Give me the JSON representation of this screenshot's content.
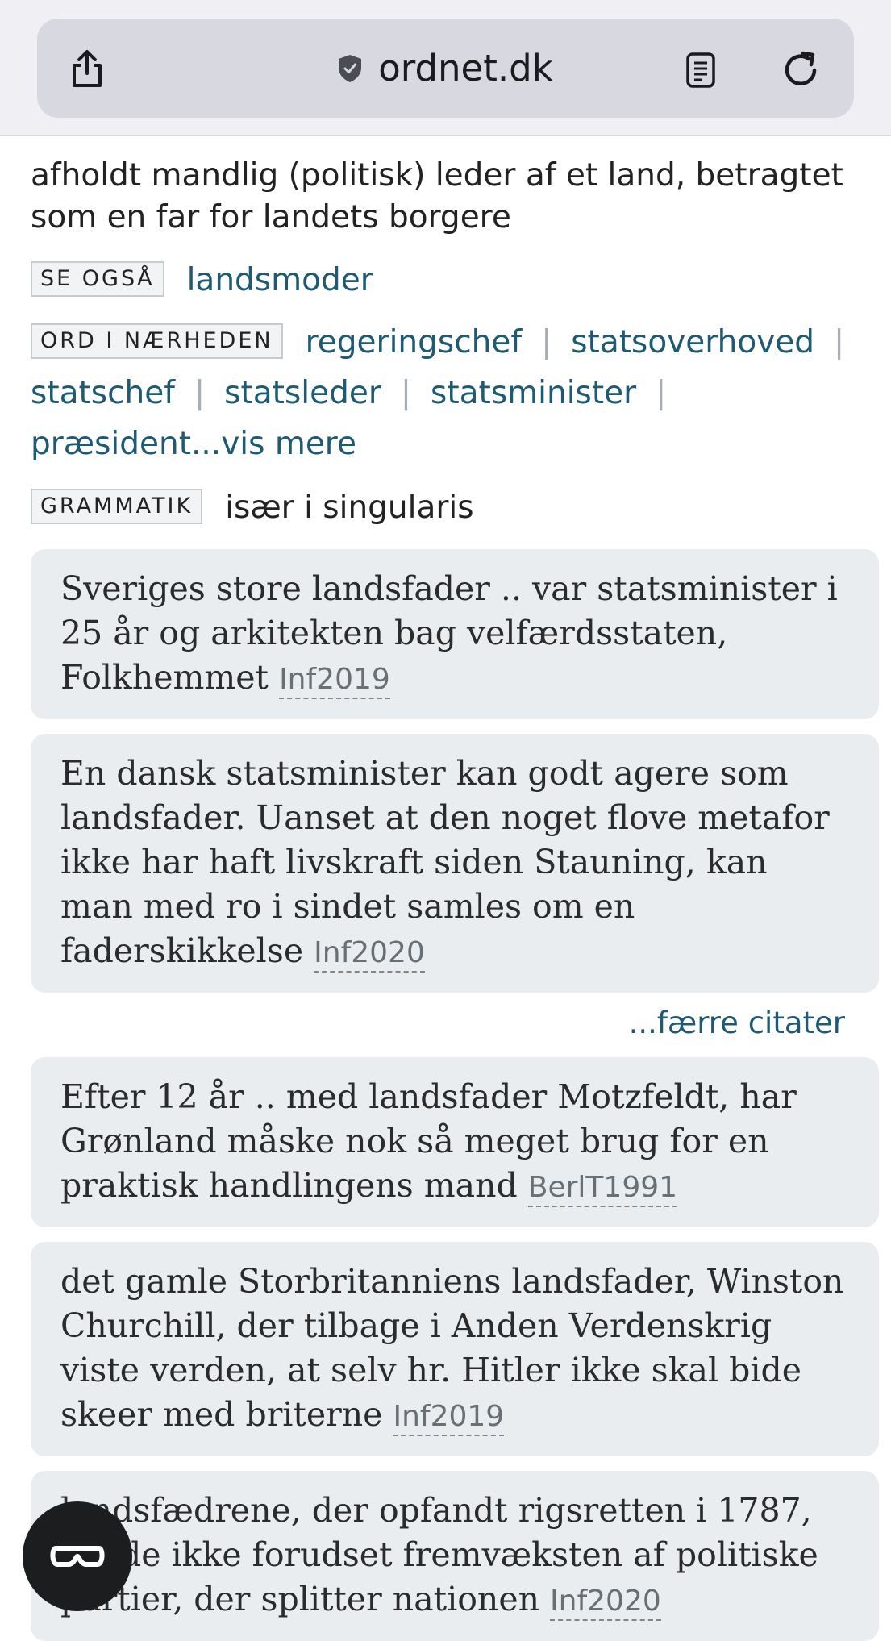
{
  "browser": {
    "url": "ordnet.dk",
    "icons": [
      "share-icon",
      "shield-icon",
      "reader-mode-icon",
      "reload-icon"
    ]
  },
  "entry": {
    "definition": "afholdt mandlig (politisk) leder af et land, betragtet som en far for landets borgere",
    "see_also": {
      "tag": "SE OGSÅ",
      "link": "landsmoder"
    },
    "nearby": {
      "tag": "ORD I NÆRHEDEN",
      "links": [
        "regeringschef",
        "statsoverhoved",
        "statschef",
        "statsleder",
        "statsminister",
        "præsident"
      ],
      "more": "...vis mere"
    },
    "grammar": {
      "tag": "GRAMMATIK",
      "text": "især i singularis"
    }
  },
  "quotes_a": [
    {
      "text": "Sveriges store landsfader .. var statsminister i 25 år og arkitekten bag velfærdsstaten, Folkhemmet",
      "source": "Inf2019"
    },
    {
      "text": "En dansk statsminister kan godt agere som landsfader. Uanset at den noget flove metafor ikke har haft livskraft siden Stauning, kan man med ro i sindet samles om en faderskikkelse",
      "source": "Inf2020"
    }
  ],
  "fewer_quotes": "...færre citater",
  "quotes_b": [
    {
      "text": "Efter 12 år .. med landsfader Motzfeldt, har Grønland måske nok så meget brug for en praktisk handlingens mand",
      "source": "BerlT1991"
    },
    {
      "text": "det gamle Storbritanniens landsfader, Winston Churchill, der tilbage i Anden Verdenskrig viste verden, at selv hr. Hitler ikke skal bide skeer med briterne",
      "source": "Inf2019"
    },
    {
      "text": "landsfædrene, der opfandt rigsretten i 1787, havde ikke forudset fremvæksten af politiske partier, der splitter nationen",
      "source": "Inf2020"
    }
  ],
  "fab": {
    "icon": "glasses-icon"
  },
  "colors": {
    "link": "#1f5a73",
    "quote_bg": "#e9edf0",
    "tag_border": "#c8cbce"
  }
}
